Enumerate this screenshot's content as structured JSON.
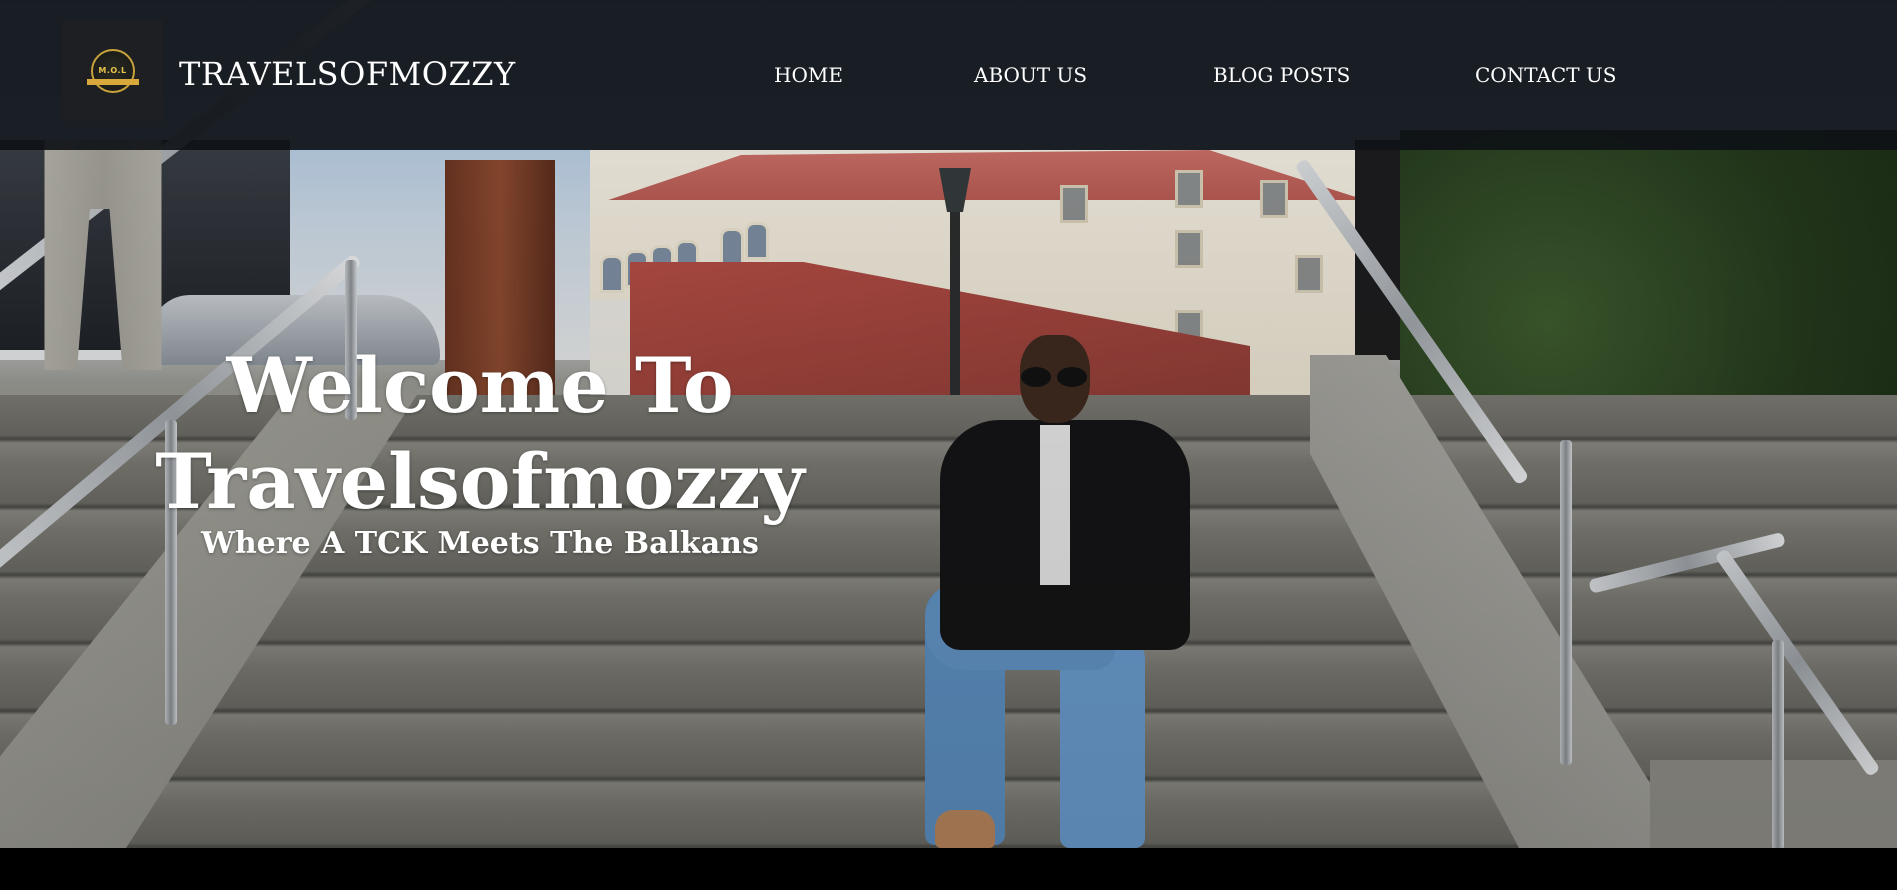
{
  "header": {
    "logo": {
      "icon": "brand-logo-icon",
      "text": "M.O.L",
      "brand_color": "#d8a83a"
    },
    "site_title": "TRAVELSOFMOZZY",
    "nav": [
      {
        "label": "HOME"
      },
      {
        "label": "ABOUT US"
      },
      {
        "label": "BLOG POSTS"
      },
      {
        "label": "CONTACT US"
      }
    ],
    "background_color": "#0e1116"
  },
  "hero": {
    "title_line1": "Welcome To",
    "title_line2": "Travelsofmozzy",
    "subtitle": "Where A TCK Meets The Balkans",
    "image": "hero-photo-man-sitting-on-stairs"
  }
}
